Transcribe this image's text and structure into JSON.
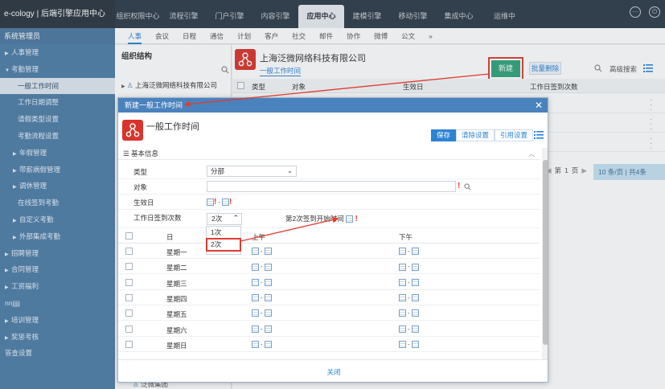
{
  "app": {
    "brand": "e-cology | 后端引擎应用中心"
  },
  "topnav": [
    "组织权限中心",
    "流程引擎",
    "门户引擎",
    "内容引擎",
    "应用中心",
    "建模引擎",
    "移动引擎",
    "集成中心",
    "运维中"
  ],
  "topnav_active": 4,
  "sidebar": {
    "title": "系统管理员",
    "items": [
      {
        "label": "人事管理",
        "level": 1,
        "arrow": true
      },
      {
        "label": "考勤管理",
        "level": 1,
        "arrow": "down"
      },
      {
        "label": "一般工作时间",
        "level": 2,
        "active": true
      },
      {
        "label": "工作日期调整",
        "level": 2
      },
      {
        "label": "请假类型设置",
        "level": 2
      },
      {
        "label": "考勤流程设置",
        "level": 2
      },
      {
        "label": "年假管理",
        "level": 2,
        "arrow": true
      },
      {
        "label": "带薪病假管理",
        "level": 2,
        "arrow": true
      },
      {
        "label": "调休管理",
        "level": 2,
        "arrow": true
      },
      {
        "label": "在线签到考勤",
        "level": 2
      },
      {
        "label": "自定义考勤",
        "level": 2,
        "arrow": true
      },
      {
        "label": "外部集成考勤",
        "level": 2,
        "arrow": true
      },
      {
        "label": "招聘管理",
        "level": 1,
        "arrow": true
      },
      {
        "label": "合同管理",
        "level": 1,
        "arrow": true
      },
      {
        "label": "工资福利",
        "level": 1,
        "arrow": true
      },
      {
        "label": "nnjjjjj",
        "level": 1
      },
      {
        "label": "培训管理",
        "level": 1,
        "arrow": true
      },
      {
        "label": "奖惩考核",
        "level": 1,
        "arrow": true
      },
      {
        "label": "答查设置",
        "level": 1
      }
    ]
  },
  "modnav": [
    "人事",
    "会议",
    "日程",
    "通信",
    "计划",
    "客户",
    "社交",
    "邮件",
    "协作",
    "微博",
    "公文",
    "»"
  ],
  "org": {
    "title": "组织结构",
    "root": "上海泛微网络科技有限公司",
    "bottom_item": "泛微集团"
  },
  "main": {
    "company": "上海泛微网络科技有限公司",
    "subtitle": "一般工作时间",
    "btn_new": "新建",
    "btn_batch_delete": "批量删除",
    "adv_search": "高级搜索",
    "columns": [
      "类型",
      "对象",
      "生效日",
      "工作日签到次数"
    ],
    "pager": {
      "prev": "◀",
      "page_label": "第",
      "page": "1",
      "page_unit": "页",
      "next": "▶",
      "size": "10  条/页 | 共4条"
    }
  },
  "modal": {
    "title": "新建一般工作时间",
    "heading": "一般工作时间",
    "actions": [
      "保存",
      "清除设置",
      "引用设置"
    ],
    "section": "基本信息",
    "fields": {
      "type_label": "类型",
      "type_value": "分部",
      "object_label": "对象",
      "effective_label": "生效日",
      "signin_label": "工作日签到次数",
      "signin_value": "2次",
      "second_start_label": "第2次签到开始时间"
    },
    "dropdown_options": [
      "1次",
      "2次"
    ],
    "grid_headers": {
      "day": "日",
      "am": "上午",
      "pm": "下午"
    },
    "days": [
      "星期一",
      "星期二",
      "星期三",
      "星期四",
      "星期五",
      "星期六",
      "星期日"
    ],
    "footer": "关闭"
  },
  "colors": {
    "accent": "#2c83d4",
    "sidebar": "#4e7ea8",
    "new_button": "#2fa37a",
    "highlight": "#e03c31",
    "modal_title": "#4a82bd"
  }
}
